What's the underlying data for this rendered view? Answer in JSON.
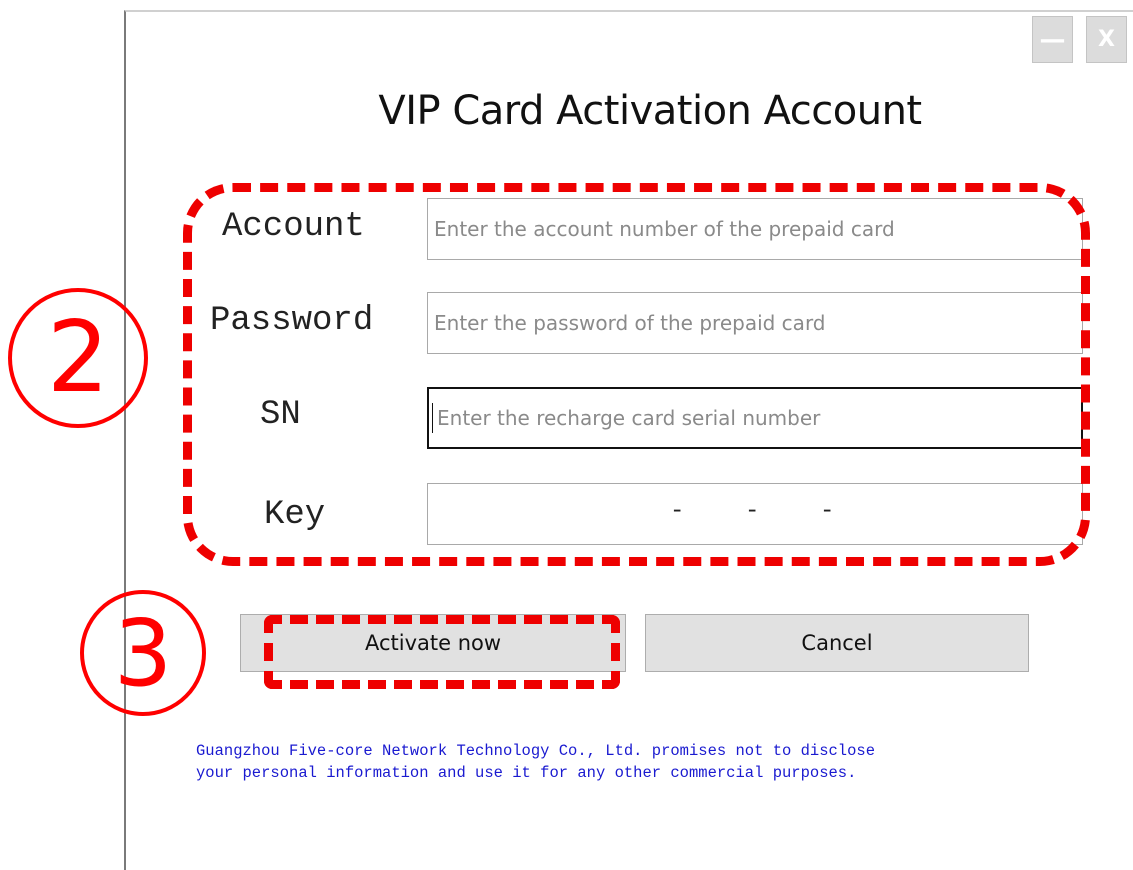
{
  "window": {
    "minimize_glyph": "—",
    "close_glyph": "X"
  },
  "dialog": {
    "title": "VIP Card Activation Account"
  },
  "form": {
    "account": {
      "label": "Account",
      "placeholder": "Enter the account number of the prepaid card",
      "value": ""
    },
    "password": {
      "label": "Password",
      "placeholder": "Enter the password of the prepaid card",
      "value": ""
    },
    "sn": {
      "label": "SN",
      "placeholder": "Enter the recharge card serial number",
      "value": ""
    },
    "key": {
      "label": "Key",
      "separator": "-"
    }
  },
  "buttons": {
    "activate_label": "Activate now",
    "cancel_label": "Cancel"
  },
  "notice": {
    "line1": "Guangzhou Five-core Network Technology Co., Ltd. promises not to disclose",
    "line2": "your personal information and use it for any other commercial purposes."
  },
  "annotations": {
    "step2_label": "2",
    "step3_label": "3",
    "color": "#ff0000"
  }
}
